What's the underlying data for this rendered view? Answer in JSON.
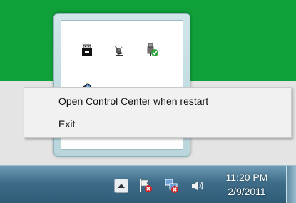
{
  "context_menu": {
    "items": [
      {
        "label": "Open Control Center when restart"
      },
      {
        "label": "Exit"
      }
    ]
  },
  "overflow_area": {
    "icons": [
      "usb-drive-icon",
      "satellite-dish-icon",
      "safely-remove-hardware-icon",
      "network-globe-icon"
    ]
  },
  "taskbar": {
    "icons": [
      "show-hidden-icons-button",
      "action-center-flag-icon",
      "network-disconnected-icon",
      "volume-icon"
    ],
    "clock": {
      "time": "11:20 PM",
      "date": "2/9/2011"
    }
  },
  "colors": {
    "desktop": "#0fa03a",
    "taskbar": "#3f6d89",
    "menu": "#f1f1f1"
  }
}
